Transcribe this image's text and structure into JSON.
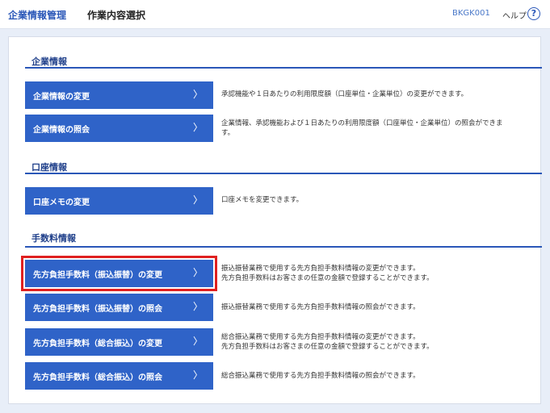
{
  "header": {
    "app_title": "企業情報管理",
    "page_title": "作業内容選択",
    "screen_code": "BKGK001",
    "help_label": "ヘルプ",
    "help_icon": "?"
  },
  "sections": [
    {
      "title": "企業情報",
      "items": [
        {
          "label": "企業情報の変更",
          "desc": [
            "承認機能や１日あたりの利用限度額（口座単位・企業単位）の変更ができます。"
          ]
        },
        {
          "label": "企業情報の照会",
          "desc": [
            "企業情報、承認機能および１日あたりの利用限度額（口座単位・企業単位）の照会ができま",
            "す。"
          ]
        }
      ]
    },
    {
      "title": "口座情報",
      "items": [
        {
          "label": "口座メモの変更",
          "desc": [
            "口座メモを変更できます。"
          ]
        }
      ]
    },
    {
      "title": "手数料情報",
      "items": [
        {
          "label": "先方負担手数料（振込振替）の変更",
          "desc": [
            "振込振替業務で使用する先方負担手数料情報の変更ができます。",
            "先方負担手数料はお客さまの任意の金額で登録することができます。"
          ],
          "selected": true
        },
        {
          "label": "先方負担手数料（振込振替）の照会",
          "desc": [
            "振込振替業務で使用する先方負担手数料情報の照会ができます。"
          ]
        },
        {
          "label": "先方負担手数料（総合振込）の変更",
          "desc": [
            "総合振込業務で使用する先方負担手数料情報の変更ができます。",
            "先方負担手数料はお客さまの任意の金額で登録することができます。"
          ]
        },
        {
          "label": "先方負担手数料（総合振込）の照会",
          "desc": [
            "総合振込業務で使用する先方負担手数料情報の照会ができます。"
          ]
        }
      ]
    }
  ],
  "chevron": "〉",
  "colors": {
    "accent": "#2a57b8",
    "button": "#2f63c8",
    "highlight": "#e02020"
  }
}
